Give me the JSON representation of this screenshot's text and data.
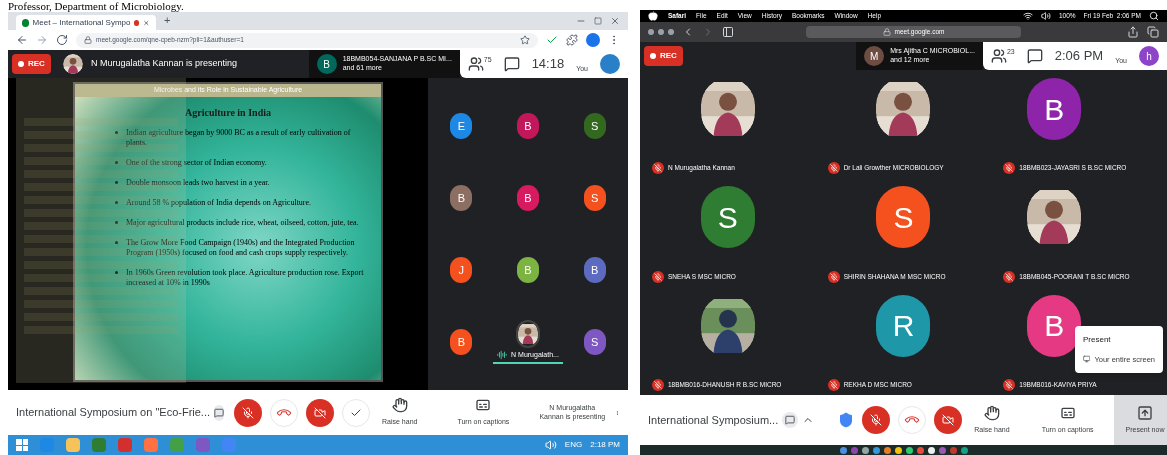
{
  "caption": "Professor, Department of Microbiology.",
  "left": {
    "tab": {
      "title": "Meet – International Sympo",
      "recording": true
    },
    "new_tab": "+",
    "url": "meet.google.com/qne-cpeb-nzm?pli=1&authuser=1",
    "meeting": {
      "rec": "REC",
      "presenting": "N Murugalatha Kannan is presenting",
      "chip": {
        "letter": "B",
        "name": "18BMB054-SANJANA P B.SC MI...",
        "more": "and 61 more"
      },
      "people_count": "75",
      "time": "14:18",
      "you": "You"
    },
    "slide": {
      "header": "Microbes and its Role in Sustainable Agriculture",
      "title": "Agriculture in India",
      "bullets": [
        "Indian agriculture began by 9000 BC as a result of early cultivation of plants.",
        "One of the strong sector of Indian economy.",
        "Double monsoon leads two harvest in a year.",
        "Around 58 % population of India depends on  Agriculture.",
        "Major agricultural products include  rice, wheat, oilseed, cotton, jute, tea.",
        "The Grow More Food Campaign (1940s) and the Integrated Production Program (1950s) focused on food and cash crops supply respectively.",
        "In 1960s Green revolution took place. Agriculture production rose. Export increased at 10% in 1990s"
      ]
    },
    "tiles": [
      {
        "kind": "letter",
        "letter": "E",
        "color": "#1e88e5"
      },
      {
        "kind": "letter",
        "letter": "B",
        "color": "#c2185b"
      },
      {
        "kind": "letter",
        "letter": "S",
        "color": "#33691e"
      },
      {
        "kind": "letter",
        "letter": "B",
        "color": "#8d6e63"
      },
      {
        "kind": "letter",
        "letter": "B",
        "color": "#d81b60"
      },
      {
        "kind": "letter",
        "letter": "S",
        "color": "#f4511e"
      },
      {
        "kind": "letter",
        "letter": "J",
        "color": "#f4511e"
      },
      {
        "kind": "letter",
        "letter": "B",
        "color": "#7cb342"
      },
      {
        "kind": "letter",
        "letter": "B",
        "color": "#5c6bc0"
      },
      {
        "kind": "letter",
        "letter": "B",
        "color": "#f4511e"
      },
      {
        "name": "N Murugalath...",
        "speaking": true
      },
      {
        "kind": "letter",
        "letter": "S",
        "color": "#7e57c2"
      }
    ],
    "controls": {
      "title": "International Symposium on \"Eco-Frie...",
      "mic_muted": true,
      "camera_off": true,
      "actions": [
        {
          "kind": "hand",
          "label": "Raise hand",
          "selected": false
        },
        {
          "kind": "captions",
          "label": "Turn on captions",
          "selected": false
        }
      ],
      "presenting": "N Murugalatha Kannan is presenting"
    },
    "taskbar": {
      "lang": "ENG",
      "time": "2:18 PM"
    }
  },
  "right": {
    "menubar": {
      "items": [
        "Safari",
        "File",
        "Edit",
        "View",
        "History",
        "Bookmarks",
        "Window",
        "Help"
      ],
      "battery": "100%",
      "datetime": "Fri 19 Feb  2:06 PM"
    },
    "url": "meet.google.com",
    "meeting": {
      "rec": "REC",
      "chip": {
        "letter": "M",
        "name": "Mrs Ajitha C MICROBIOL...",
        "more": "and 12 more"
      },
      "people_count": "23",
      "time": "2:06 PM",
      "you": "You",
      "avatar": "h"
    },
    "tiles": [
      {
        "name": "N Murugalatha Kannan",
        "muted": true
      },
      {
        "name": "Dr Lali Growther MICROBIOLOGY",
        "muted": true
      },
      {
        "kind": "letter",
        "letter": "B",
        "color": "#8e24aa",
        "name": "18BMB023-JAYASRI S B.SC MICRO",
        "muted": true
      },
      {
        "kind": "letter",
        "letter": "S",
        "color": "#2e7d32",
        "name": "SNEHA S MSC MICRO",
        "muted": true
      },
      {
        "kind": "letter",
        "letter": "S",
        "color": "#f4511e",
        "name": "SHIRIN SHAHANA M MSC MICRO",
        "muted": true
      },
      {
        "name": "18BMB045-POORANI T B.SC MICRO",
        "muted": true
      },
      {
        "name": "18BMB016-DHANUSH R B.SC MICRO",
        "muted": true
      },
      {
        "kind": "letter",
        "letter": "R",
        "color": "#1e97a8",
        "name": "REKHA D MSC MICRO",
        "muted": true
      },
      {
        "kind": "letter",
        "letter": "B",
        "color": "#e53984",
        "name": "19BMB016-KAVIYA PRIYA",
        "muted": true
      }
    ],
    "popup": {
      "title": "Present",
      "option": "Your entire screen"
    },
    "controls": {
      "title": "International Symposium...",
      "mic_muted": true,
      "camera_off": true,
      "actions": [
        {
          "kind": "hand",
          "label": "Raise hand",
          "selected": false
        },
        {
          "kind": "captions",
          "label": "Turn on captions",
          "selected": false
        },
        {
          "kind": "present",
          "label": "Present now",
          "selected": true
        }
      ]
    }
  }
}
